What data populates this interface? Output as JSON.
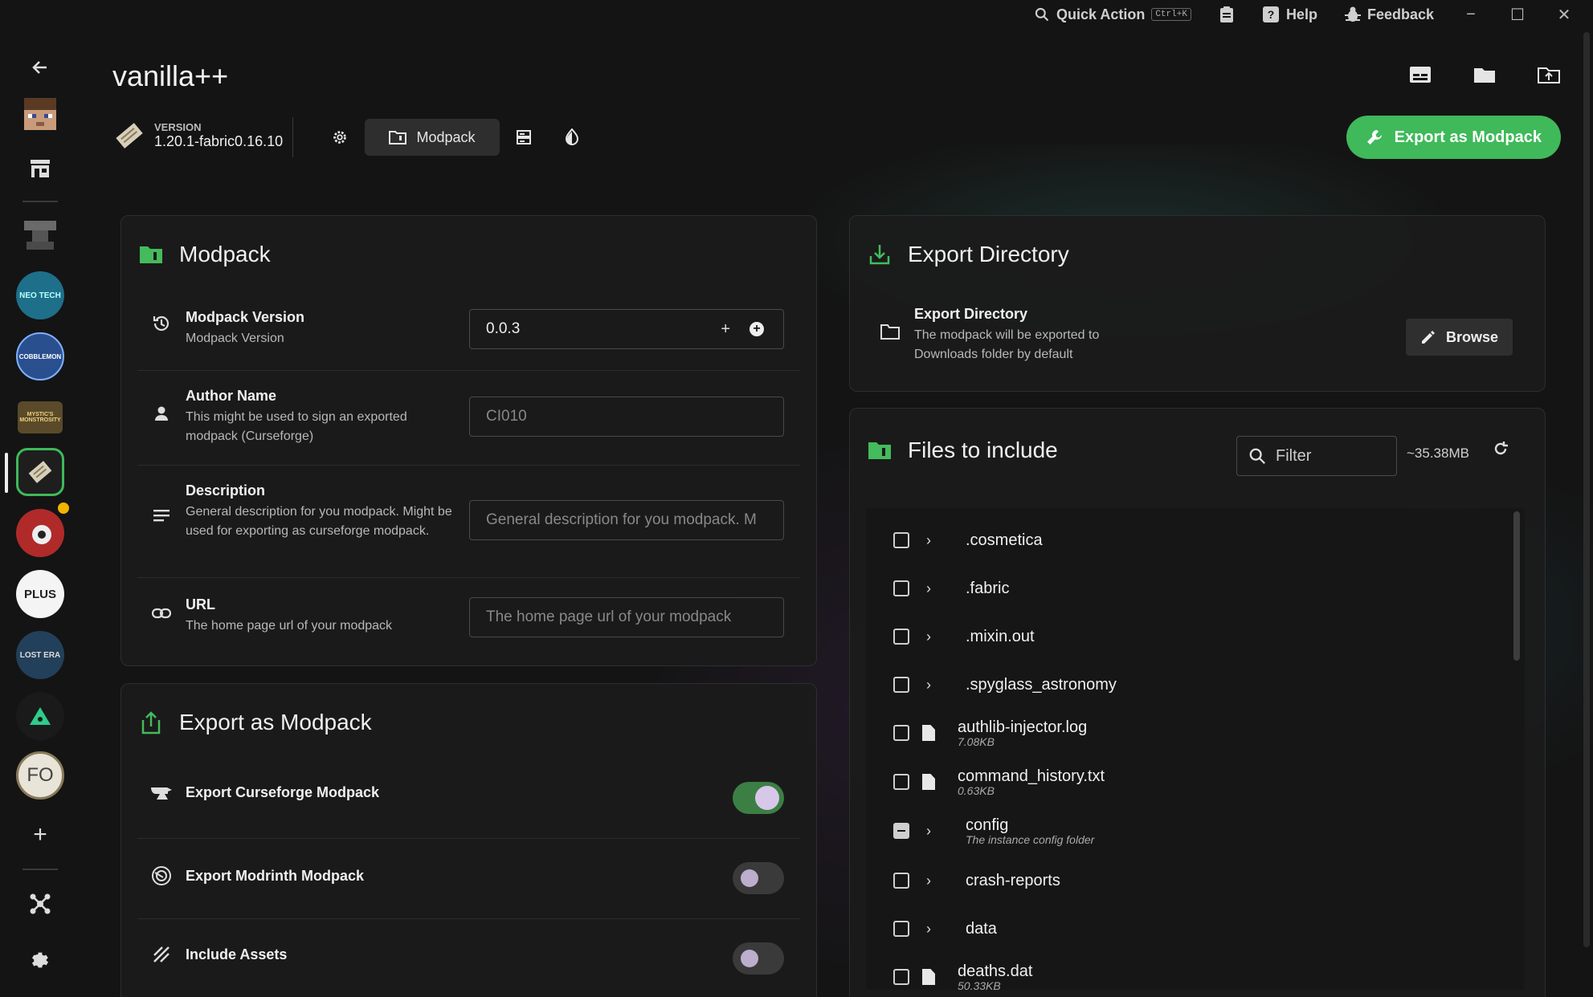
{
  "topbar": {
    "quick_action": "Quick Action",
    "shortcut": "Ctrl+K",
    "help": "Help",
    "feedback": "Feedback"
  },
  "instance": {
    "title": "vanilla++",
    "version_label": "VERSION",
    "version_value": "1.20.1-fabric0.16.10"
  },
  "tabs": {
    "active_label": "Modpack"
  },
  "header": {
    "export_button": "Export as Modpack"
  },
  "modpack_card": {
    "title": "Modpack",
    "rows": [
      {
        "title": "Modpack Version",
        "desc": "Modpack Version",
        "value": "0.0.3"
      },
      {
        "title": "Author Name",
        "desc": "This might be used to sign an exported modpack (Curseforge)",
        "placeholder": "CI010"
      },
      {
        "title": "Description",
        "desc": "General description for you modpack. Might be used for exporting as curseforge modpack.",
        "placeholder": "General description for you modpack. M"
      },
      {
        "title": "URL",
        "desc": "The home page url of your modpack",
        "placeholder": "The home page url of your modpack"
      }
    ]
  },
  "export_card": {
    "title": "Export as Modpack",
    "rows": [
      {
        "label": "Export Curseforge Modpack",
        "enabled": true
      },
      {
        "label": "Export Modrinth Modpack",
        "enabled": false
      },
      {
        "label": "Include Assets",
        "enabled": false
      }
    ]
  },
  "export_dir_card": {
    "title": "Export Directory",
    "row_title": "Export Directory",
    "row_desc": "The modpack will be exported to Downloads folder by default",
    "browse": "Browse"
  },
  "files_card": {
    "title": "Files to include",
    "filter_placeholder": "Filter",
    "total_size": "~35.38MB",
    "files": [
      {
        "name": ".cosmetica",
        "type": "folder",
        "checked": "unchecked",
        "sub": ""
      },
      {
        "name": ".fabric",
        "type": "folder",
        "checked": "unchecked",
        "sub": ""
      },
      {
        "name": ".mixin.out",
        "type": "folder",
        "checked": "unchecked",
        "sub": ""
      },
      {
        "name": ".spyglass_astronomy",
        "type": "folder",
        "checked": "unchecked",
        "sub": ""
      },
      {
        "name": "authlib-injector.log",
        "type": "file",
        "checked": "unchecked",
        "sub": "7.08KB"
      },
      {
        "name": "command_history.txt",
        "type": "file",
        "checked": "unchecked",
        "sub": "0.63KB"
      },
      {
        "name": "config",
        "type": "folder",
        "checked": "partial",
        "sub": "The instance config folder"
      },
      {
        "name": "crash-reports",
        "type": "folder",
        "checked": "unchecked",
        "sub": ""
      },
      {
        "name": "data",
        "type": "folder",
        "checked": "unchecked",
        "sub": ""
      },
      {
        "name": "deaths.dat",
        "type": "file",
        "checked": "unchecked",
        "sub": "50.33KB"
      }
    ]
  },
  "sidebar": {
    "instance_labels": [
      "NEO TECH",
      "COBBLEMON",
      "MYSTIC'S MONSTROSITY",
      "PLUS",
      "LOST ERA",
      "FO"
    ]
  },
  "colors": {
    "accent": "#3fb95a",
    "background": "#141414",
    "card": "#1b1b1b"
  }
}
